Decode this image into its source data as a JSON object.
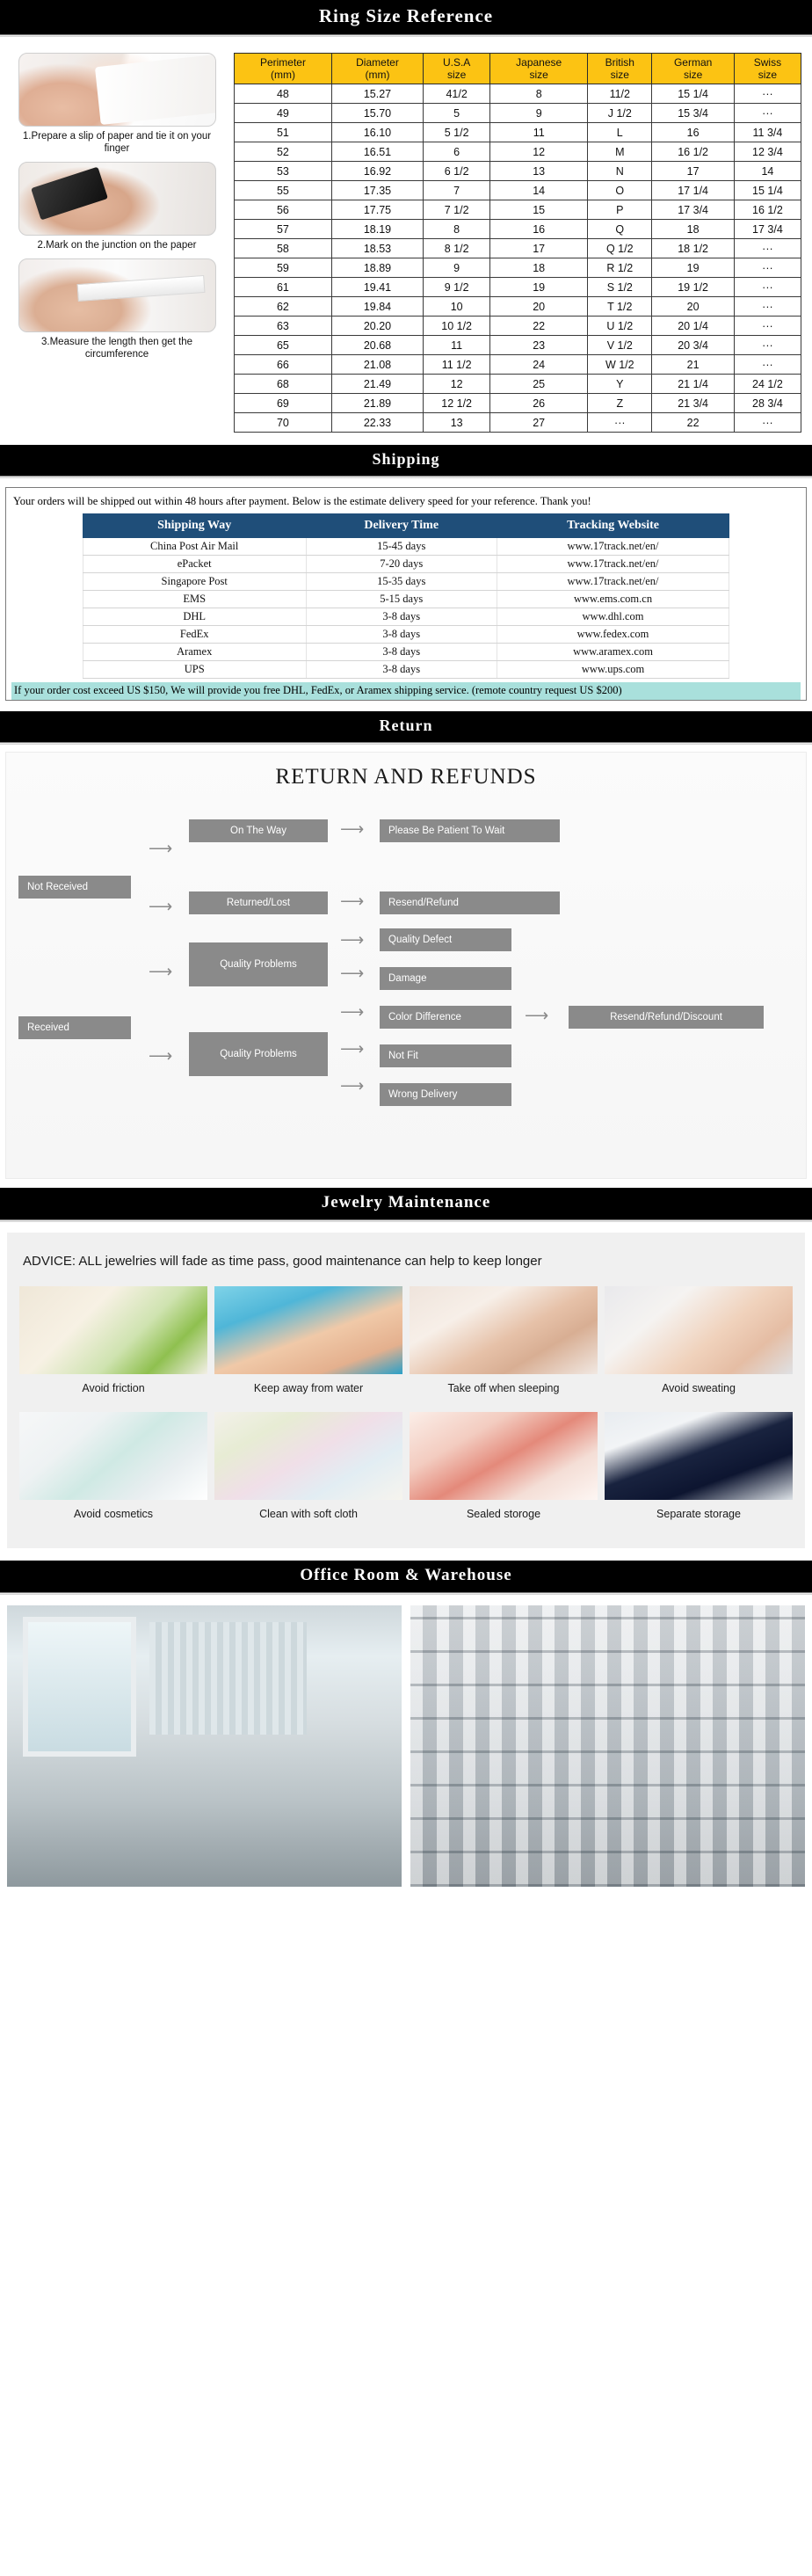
{
  "sections": {
    "ring_size": {
      "title": "Ring  Size  Reference"
    },
    "shipping": {
      "title": "Shipping"
    },
    "return": {
      "title": "Return"
    },
    "maintenance": {
      "title": "Jewelry  Maintenance"
    },
    "office": {
      "title": "Office Room & Warehouse"
    }
  },
  "ring_steps": [
    {
      "caption": "1.Prepare a slip of paper and tie it on your finger"
    },
    {
      "caption": "2.Mark on the junction on the paper"
    },
    {
      "caption": "3.Measure the length then get the circumference"
    }
  ],
  "ring_table": {
    "headers": [
      "Perimeter\n(mm)",
      "Diameter\n(mm)",
      "U.S.A\nsize",
      "Japanese\nsize",
      "British\nsize",
      "German\nsize",
      "Swiss\nsize"
    ],
    "rows": [
      [
        "48",
        "15.27",
        "41/2",
        "8",
        "11/2",
        "15 1/4",
        "···"
      ],
      [
        "49",
        "15.70",
        "5",
        "9",
        "J 1/2",
        "15 3/4",
        "···"
      ],
      [
        "51",
        "16.10",
        "5 1/2",
        "11",
        "L",
        "16",
        "11 3/4"
      ],
      [
        "52",
        "16.51",
        "6",
        "12",
        "M",
        "16 1/2",
        "12 3/4"
      ],
      [
        "53",
        "16.92",
        "6 1/2",
        "13",
        "N",
        "17",
        "14"
      ],
      [
        "55",
        "17.35",
        "7",
        "14",
        "O",
        "17 1/4",
        "15 1/4"
      ],
      [
        "56",
        "17.75",
        "7 1/2",
        "15",
        "P",
        "17 3/4",
        "16 1/2"
      ],
      [
        "57",
        "18.19",
        "8",
        "16",
        "Q",
        "18",
        "17 3/4"
      ],
      [
        "58",
        "18.53",
        "8 1/2",
        "17",
        "Q 1/2",
        "18 1/2",
        "···"
      ],
      [
        "59",
        "18.89",
        "9",
        "18",
        "R 1/2",
        "19",
        "···"
      ],
      [
        "61",
        "19.41",
        "9 1/2",
        "19",
        "S 1/2",
        "19 1/2",
        "···"
      ],
      [
        "62",
        "19.84",
        "10",
        "20",
        "T 1/2",
        "20",
        "···"
      ],
      [
        "63",
        "20.20",
        "10 1/2",
        "22",
        "U 1/2",
        "20 1/4",
        "···"
      ],
      [
        "65",
        "20.68",
        "11",
        "23",
        "V 1/2",
        "20 3/4",
        "···"
      ],
      [
        "66",
        "21.08",
        "11 1/2",
        "24",
        "W 1/2",
        "21",
        "···"
      ],
      [
        "68",
        "21.49",
        "12",
        "25",
        "Y",
        "21 1/4",
        "24 1/2"
      ],
      [
        "69",
        "21.89",
        "12 1/2",
        "26",
        "Z",
        "21 3/4",
        "28 3/4"
      ],
      [
        "70",
        "22.33",
        "13",
        "27",
        "···",
        "22",
        "···"
      ]
    ]
  },
  "shipping": {
    "intro": "Your orders will be shipped out within 48 hours after payment. Below is the estimate delivery speed for your reference. Thank you!",
    "headers": [
      "Shipping Way",
      "Delivery Time",
      "Tracking Website"
    ],
    "rows": [
      [
        "China Post Air Mail",
        "15-45 days",
        "www.17track.net/en/"
      ],
      [
        "ePacket",
        "7-20 days",
        "www.17track.net/en/"
      ],
      [
        "Singapore Post",
        "15-35 days",
        "www.17track.net/en/"
      ],
      [
        "EMS",
        "5-15 days",
        "www.ems.com.cn"
      ],
      [
        "DHL",
        "3-8 days",
        "www.dhl.com"
      ],
      [
        "FedEx",
        "3-8 days",
        "www.fedex.com"
      ],
      [
        "Aramex",
        "3-8 days",
        "www.aramex.com"
      ],
      [
        "UPS",
        "3-8 days",
        "www.ups.com"
      ]
    ],
    "note": "If your order cost exceed US $150, We will provide you free DHL, FedEx, or Aramex shipping service. (remote country request US $200)"
  },
  "return": {
    "title": "RETURN AND REFUNDS",
    "nodes": {
      "not_received": "Not Received",
      "on_the_way": "On The Way",
      "please_wait": "Please Be Patient To Wait",
      "returned_lost": "Returned/Lost",
      "resend_refund": "Resend/Refund",
      "received": "Received",
      "quality_problems_1": "Quality Problems",
      "quality_problems_2": "Quality Problems",
      "quality_defect": "Quality Defect",
      "damage": "Damage",
      "color_difference": "Color Difference",
      "not_fit": "Not Fit",
      "wrong_delivery": "Wrong Delivery",
      "resend_refund_discount": "Resend/Refund/Discount"
    }
  },
  "maintenance": {
    "advice": "ADVICE: ALL jewelries will fade as time pass, good maintenance can help to keep longer",
    "items": [
      {
        "caption": "Avoid friction",
        "icon": "soap-bowl-icon"
      },
      {
        "caption": "Keep away from water",
        "icon": "swimming-icon"
      },
      {
        "caption": "Take off when sleeping",
        "icon": "sleeping-icon"
      },
      {
        "caption": "Avoid sweating",
        "icon": "sweating-icon"
      },
      {
        "caption": "Avoid cosmetics",
        "icon": "cosmetics-icon"
      },
      {
        "caption": "Clean with soft cloth",
        "caption_alt": "",
        "icon": "cloth-icon"
      },
      {
        "caption": "Sealed storoge",
        "icon": "sealed-bag-icon"
      },
      {
        "caption": "Separate storage",
        "icon": "jewelry-box-icon"
      }
    ]
  },
  "office": {
    "photos": [
      {
        "name": "office-room-photo"
      },
      {
        "name": "warehouse-photo"
      }
    ]
  }
}
